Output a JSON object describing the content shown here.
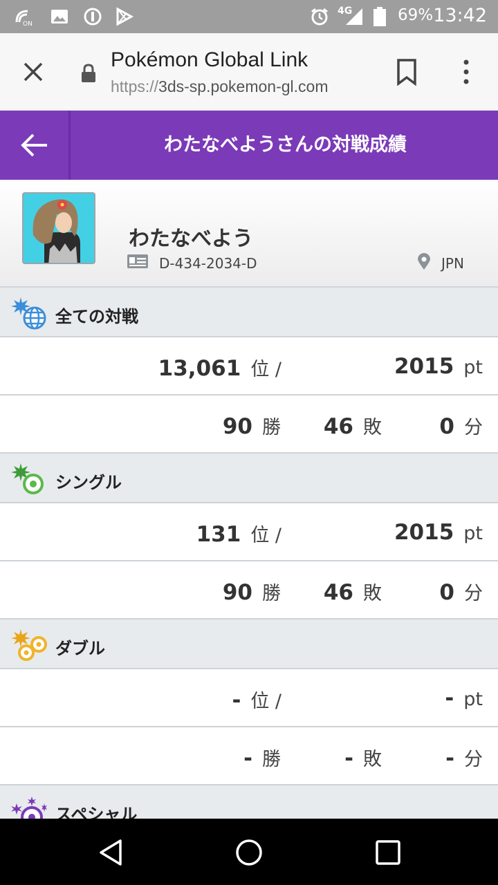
{
  "status_bar": {
    "battery": "69%",
    "time": "13:42",
    "network": "4G",
    "icons": [
      "nfc-on-icon",
      "image-icon",
      "blocked-icon",
      "play-store-icon",
      "alarm-icon",
      "signal-icon",
      "battery-icon"
    ]
  },
  "browser": {
    "page_title": "Pokémon Global Link",
    "url_scheme": "https://",
    "url_host": "3ds-sp.pokemon-gl.com",
    "icons": [
      "close-icon",
      "lock-icon",
      "bookmark-icon",
      "more-vert-icon"
    ]
  },
  "header": {
    "title": "わたなべようさんの対戦成績",
    "back_icon": "arrow-left-icon",
    "color": "#7b3ab8"
  },
  "profile": {
    "name": "わたなべよう",
    "player_id": "D-434-2034-D",
    "country": "JPN"
  },
  "sections": [
    {
      "label": "全ての対戦",
      "icon": "globe-icon",
      "rank": "13,061",
      "rank_unit": "位 /",
      "points": "2015",
      "points_unit": "pt",
      "wins": "90",
      "wins_unit": "勝",
      "losses": "46",
      "losses_unit": "敗",
      "draws": "0",
      "draws_unit": "分"
    },
    {
      "label": "シングル",
      "icon": "single-battle-icon",
      "rank": "131",
      "rank_unit": "位 /",
      "points": "2015",
      "points_unit": "pt",
      "wins": "90",
      "wins_unit": "勝",
      "losses": "46",
      "losses_unit": "敗",
      "draws": "0",
      "draws_unit": "分"
    },
    {
      "label": "ダブル",
      "icon": "double-battle-icon",
      "rank": "-",
      "rank_unit": "位 /",
      "points": "-",
      "points_unit": "pt",
      "wins": "-",
      "wins_unit": "勝",
      "losses": "-",
      "losses_unit": "敗",
      "draws": "-",
      "draws_unit": "分"
    },
    {
      "label": "スペシャル",
      "icon": "special-battle-icon"
    }
  ],
  "nav_bar": {
    "icons": [
      "back-triangle-icon",
      "home-circle-icon",
      "recents-square-icon"
    ]
  }
}
